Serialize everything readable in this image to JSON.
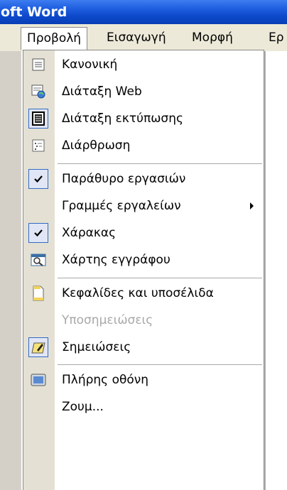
{
  "window": {
    "title": "oft Word"
  },
  "menubar": {
    "items": [
      {
        "label": "Προβολή",
        "active": true
      },
      {
        "label": "Εισαγωγή",
        "active": false
      },
      {
        "label": "Μορφή",
        "active": false
      },
      {
        "label": "Ερ",
        "active": false
      }
    ]
  },
  "view_menu": {
    "items": [
      {
        "label": "Κανονική",
        "icon": "normal-view-icon",
        "enabled": true
      },
      {
        "label": "Διάταξη Web",
        "icon": "web-layout-icon",
        "enabled": true
      },
      {
        "label": "Διάταξη εκτύπωσης",
        "icon": "print-layout-icon",
        "enabled": true,
        "selected": true
      },
      {
        "label": "Διάρθρωση",
        "icon": "outline-icon",
        "enabled": true
      },
      {
        "label": "Παράθυρο εργασιών",
        "icon": "checkmark-icon",
        "enabled": true,
        "checked": true
      },
      {
        "label": "Γραμμές εργαλείων",
        "icon": null,
        "enabled": true,
        "submenu": true
      },
      {
        "label": "Χάρακας",
        "icon": "checkmark-icon",
        "enabled": true,
        "checked": true
      },
      {
        "label": "Χάρτης εγγράφου",
        "icon": "document-map-icon",
        "enabled": true
      },
      {
        "label": "Κεφαλίδες και υποσέλιδα",
        "icon": "header-footer-icon",
        "enabled": true
      },
      {
        "label": "Υποσημειώσεις",
        "icon": null,
        "enabled": false
      },
      {
        "label": "Σημειώσεις",
        "icon": "comments-icon",
        "enabled": true,
        "selected": true
      },
      {
        "label": "Πλήρης οθόνη",
        "icon": "full-screen-icon",
        "enabled": true
      },
      {
        "label": "Ζουμ...",
        "icon": null,
        "enabled": true
      }
    ]
  }
}
